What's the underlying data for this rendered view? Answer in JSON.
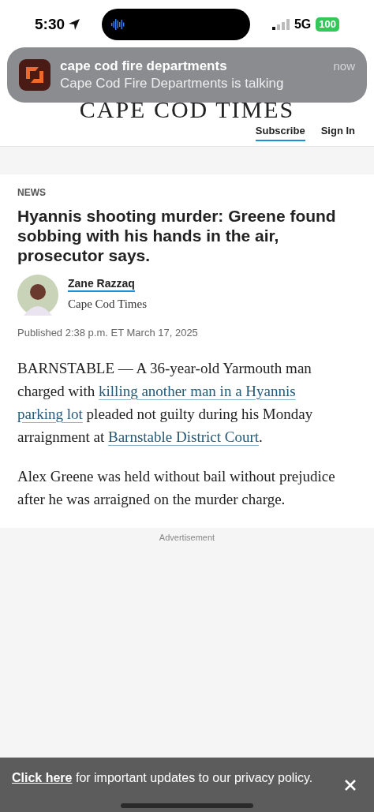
{
  "status_bar": {
    "time": "5:30",
    "network": "5G",
    "battery": "100"
  },
  "notification": {
    "app": "cape cod fire departments",
    "message": "Cape Cod Fire Departments is talking",
    "time": "now"
  },
  "header": {
    "masthead": "CAPE COD TIMES",
    "links": [
      {
        "label": "Subscribe",
        "underlined": true
      },
      {
        "label": "Sign In",
        "underlined": false
      }
    ]
  },
  "article": {
    "section": "NEWS",
    "headline": "Hyannis shooting murder: Greene found sobbing with his hands in the air, prosecutor says.",
    "author": {
      "name": "Zane Razzaq",
      "outlet": "Cape Cod Times"
    },
    "published": "Published 2:38 p.m. ET March 17, 2025",
    "paragraphs": [
      [
        {
          "text": "BARNSTABLE — A 36-year-old Yarmouth man charged with ",
          "kind": "text"
        },
        {
          "text": "killing another man in a Hyannis",
          "kind": "link"
        },
        {
          "text": "parking lot",
          "kind": "link"
        },
        {
          "text": " pleaded not guilty during his Monday arraignment at ",
          "kind": "text"
        },
        {
          "text": "Barnstable District Court",
          "kind": "link"
        },
        {
          "text": ".",
          "kind": "text"
        }
      ],
      [
        {
          "text": "Alex Greene was held without bail without prejudice after he was arraigned on the murder charge.",
          "kind": "text"
        }
      ]
    ]
  },
  "advertisement": {
    "label": "Advertisement"
  },
  "privacy_banner": {
    "link": "Click here",
    "text": "for important updates to our privacy policy."
  }
}
